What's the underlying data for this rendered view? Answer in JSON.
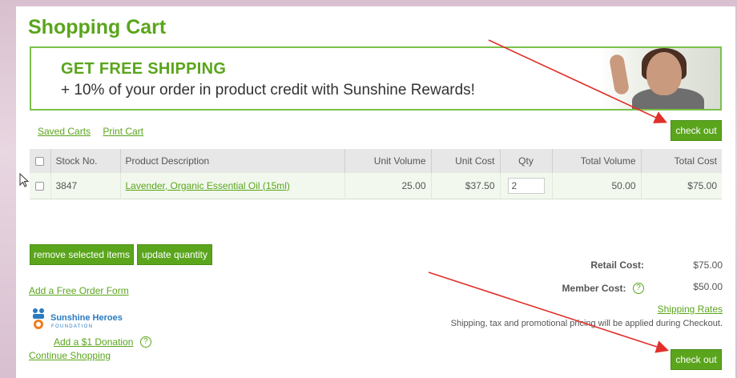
{
  "page": {
    "title": "Shopping Cart"
  },
  "banner": {
    "headline": "GET FREE SHIPPING",
    "subline": "+ 10% of your order in product credit with Sunshine Rewards!"
  },
  "links": {
    "saved_carts": "Saved Carts",
    "print_cart": "Print Cart"
  },
  "checkout_label": "check out",
  "table": {
    "headers": [
      "Stock No.",
      "Product Description",
      "Unit Volume",
      "Unit Cost",
      "Qty",
      "Total Volume",
      "Total Cost"
    ],
    "rows": [
      {
        "stock_no": "3847",
        "description": "Lavender, Organic Essential Oil (15ml)",
        "unit_volume": "25.00",
        "unit_cost": "$37.50",
        "qty": "2",
        "total_volume": "50.00",
        "total_cost": "$75.00"
      }
    ]
  },
  "actions": {
    "remove": "remove selected items",
    "update": "update quantity",
    "free_order_form": "Add a Free Order Form",
    "donation": "Add a $1 Donation",
    "continue": "Continue Shopping"
  },
  "logo": {
    "name": "Sunshine Heroes",
    "subtitle": "FOUNDATION"
  },
  "summary": {
    "retail_label": "Retail Cost:",
    "retail_value": "$75.00",
    "member_label": "Member Cost:",
    "member_value": "$50.00",
    "shipping_rates": "Shipping Rates",
    "note": "Shipping, tax and promotional pricing will be applied during Checkout."
  },
  "colors": {
    "brand_green": "#5aa51c",
    "annotation_red": "#e0302a"
  }
}
